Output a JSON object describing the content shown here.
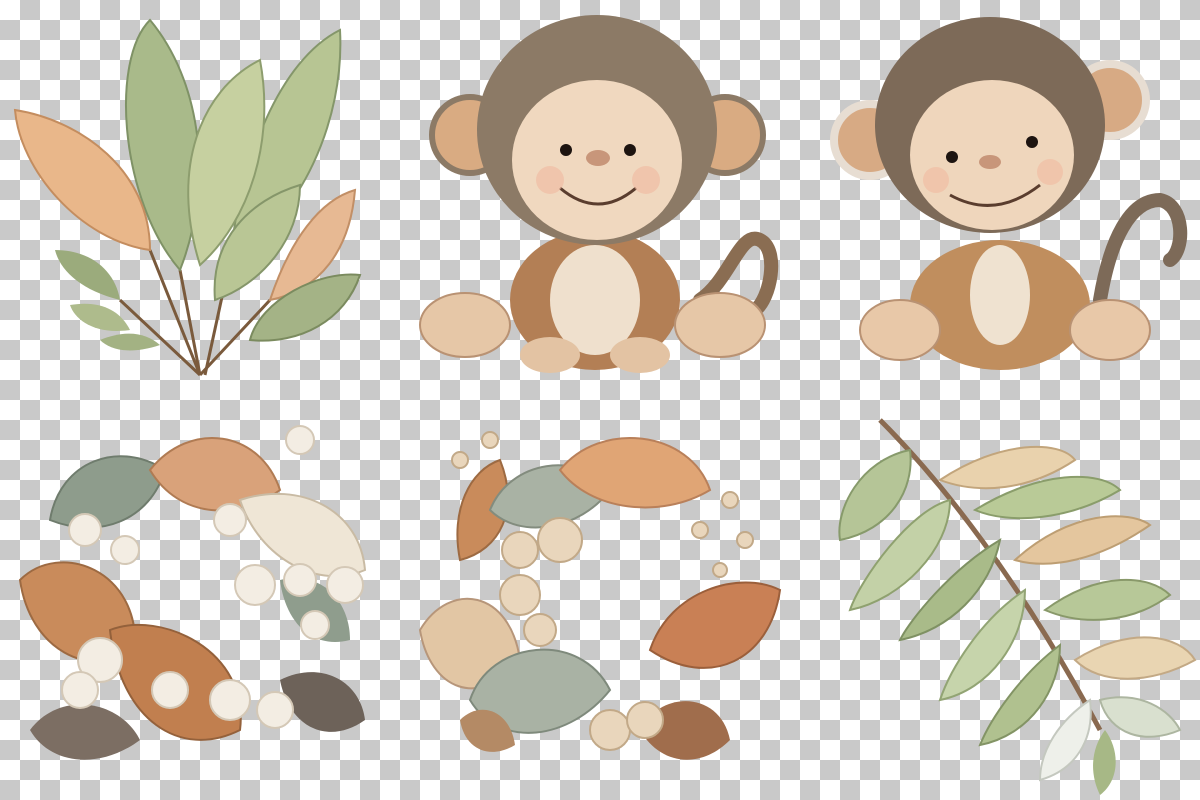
{
  "background": {
    "pattern": "transparency-checkerboard",
    "light": "#ffffff",
    "dark": "#c9c9c9"
  },
  "illustrations": [
    {
      "name": "tropical-leaf-bouquet",
      "palette": [
        "#a8b888",
        "#e8b58a",
        "#c7cf9f"
      ]
    },
    {
      "name": "fluffy-monkey-sitting",
      "palette": [
        "#8c7a66",
        "#b9825a",
        "#f0d8bf"
      ]
    },
    {
      "name": "monkey-in-jacket-sitting",
      "palette": [
        "#7d6a58",
        "#c08e5e",
        "#efd6bc"
      ]
    },
    {
      "name": "boho-leaf-wreath-left",
      "palette": [
        "#c98b5b",
        "#f3ede3",
        "#8e9c8c"
      ]
    },
    {
      "name": "boho-leaf-wreath-center",
      "palette": [
        "#c98b5b",
        "#e2c6a4",
        "#a9b2a4"
      ]
    },
    {
      "name": "eucalyptus-branch",
      "palette": [
        "#b8c79a",
        "#e9d2ad",
        "#8a6a50"
      ]
    }
  ]
}
